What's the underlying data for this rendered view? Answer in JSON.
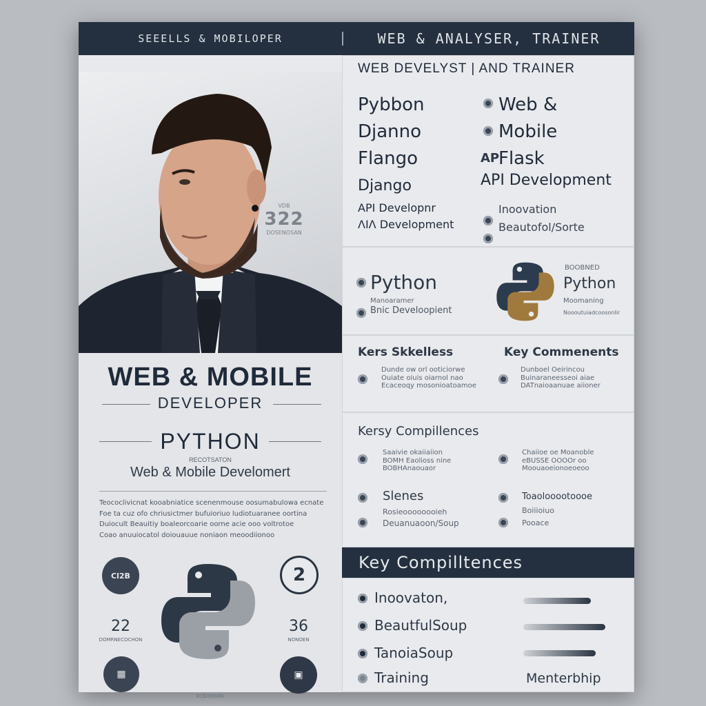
{
  "header": {
    "left_text": "SEEELLS & MOBILOPER",
    "right_text": "WEB & ANALYSER, TRAINER"
  },
  "photo": {
    "tag_top": "VDB",
    "tag_num": "322",
    "tag_small": "DOSENOSAN"
  },
  "left": {
    "title1": "WEB & MOBILE",
    "title2": "DEVELOPER",
    "title3": "PYTHON",
    "tiny_label": "RECOTSATON",
    "subtitle": "Web & Mobile Develomert",
    "para1": "Teococlivicnat kooabniatice scenenmouse oosumabulowa ecnate",
    "para2": "Foe ta cuz ofo chriusictmer bufuioriuo ludiotuaranee oortina",
    "para3": "Duiocult Beauitiy boaleorcoarie oorne acie ooo voltrotoe",
    "para4": "Coao anuuiocatol doiouauue noniaon meoodiionoo",
    "icon_tl_text": "Cl2B",
    "num_left": "22",
    "num_left_sub": "DOMRNECOCHON",
    "icon_tr_text": "2",
    "num_right": "36",
    "num_right_sub": "NONOEN",
    "bottom_caption": "ECBIKOGRA"
  },
  "right_top": {
    "heading": "WEB DEVELYST | AND TRAINER",
    "col1": [
      "Pybbon",
      "Djanno",
      "Flango",
      "Django",
      "API Developnr",
      "ΛΙΛ Development"
    ],
    "col2_prefixes": [
      "",
      "",
      "AP",
      "",
      "",
      ""
    ],
    "col2": [
      "Web &",
      "Mobile",
      "Flask",
      "API Development",
      "Inoovation",
      "Beautofol/Sorte"
    ]
  },
  "python_panel": {
    "left_title": "Python",
    "left_small": "Manoaramer",
    "left_sub": "Bnic Develoopient",
    "right_small_top": "BOOBNED",
    "right_title": "Python",
    "right_small": "Moomaning",
    "right_sub": "Noooutuiadcoosonlir"
  },
  "skills_panel": {
    "left_heading": "Kers Skkelless",
    "right_heading": "Key Commenents",
    "left_lines": [
      "Dunde ow orl ooticiorwe",
      "Ouiate oiuis oiarnol nao",
      "Ecaceoqy mosonioatoamoe"
    ],
    "right_lines": [
      "Dunboel Oeirincou",
      "Buinaraneesseoi aiae",
      "DATnaioaanuae aiioner"
    ]
  },
  "comp_panel": {
    "heading": "Kersy Compillences",
    "left_lines1": [
      "Saaivie okaiiaiion",
      "BOMH Eaolioss nine",
      "BOBHAnaouaor"
    ],
    "right_lines1": [
      "Chaiioe oe Moanoble",
      "eBUSSE OOOOr oo",
      "Moouaoeionoeoeoo"
    ],
    "left_title2": "Slenes",
    "left_sub2": "Rosieoooooooieh",
    "left_sub3": "Deuanuaoon/Soup",
    "right_title2": "Toaolooootoooe",
    "right_sub2": "Boiiioiuo",
    "right_sub3": "Pooace"
  },
  "competences": {
    "bar_title": "Key Compilltences",
    "items": [
      "Inoovaton,",
      "BeautfulSoup",
      "TanoiaSoup",
      "Training"
    ],
    "extra": "Menterbhip",
    "levels": [
      0.7,
      0.85,
      0.75
    ]
  },
  "colors": {
    "navy": "#24303f",
    "paper": "#e8e9ec",
    "python_blue": "#2d3b4f",
    "python_gold": "#a07a3c"
  }
}
